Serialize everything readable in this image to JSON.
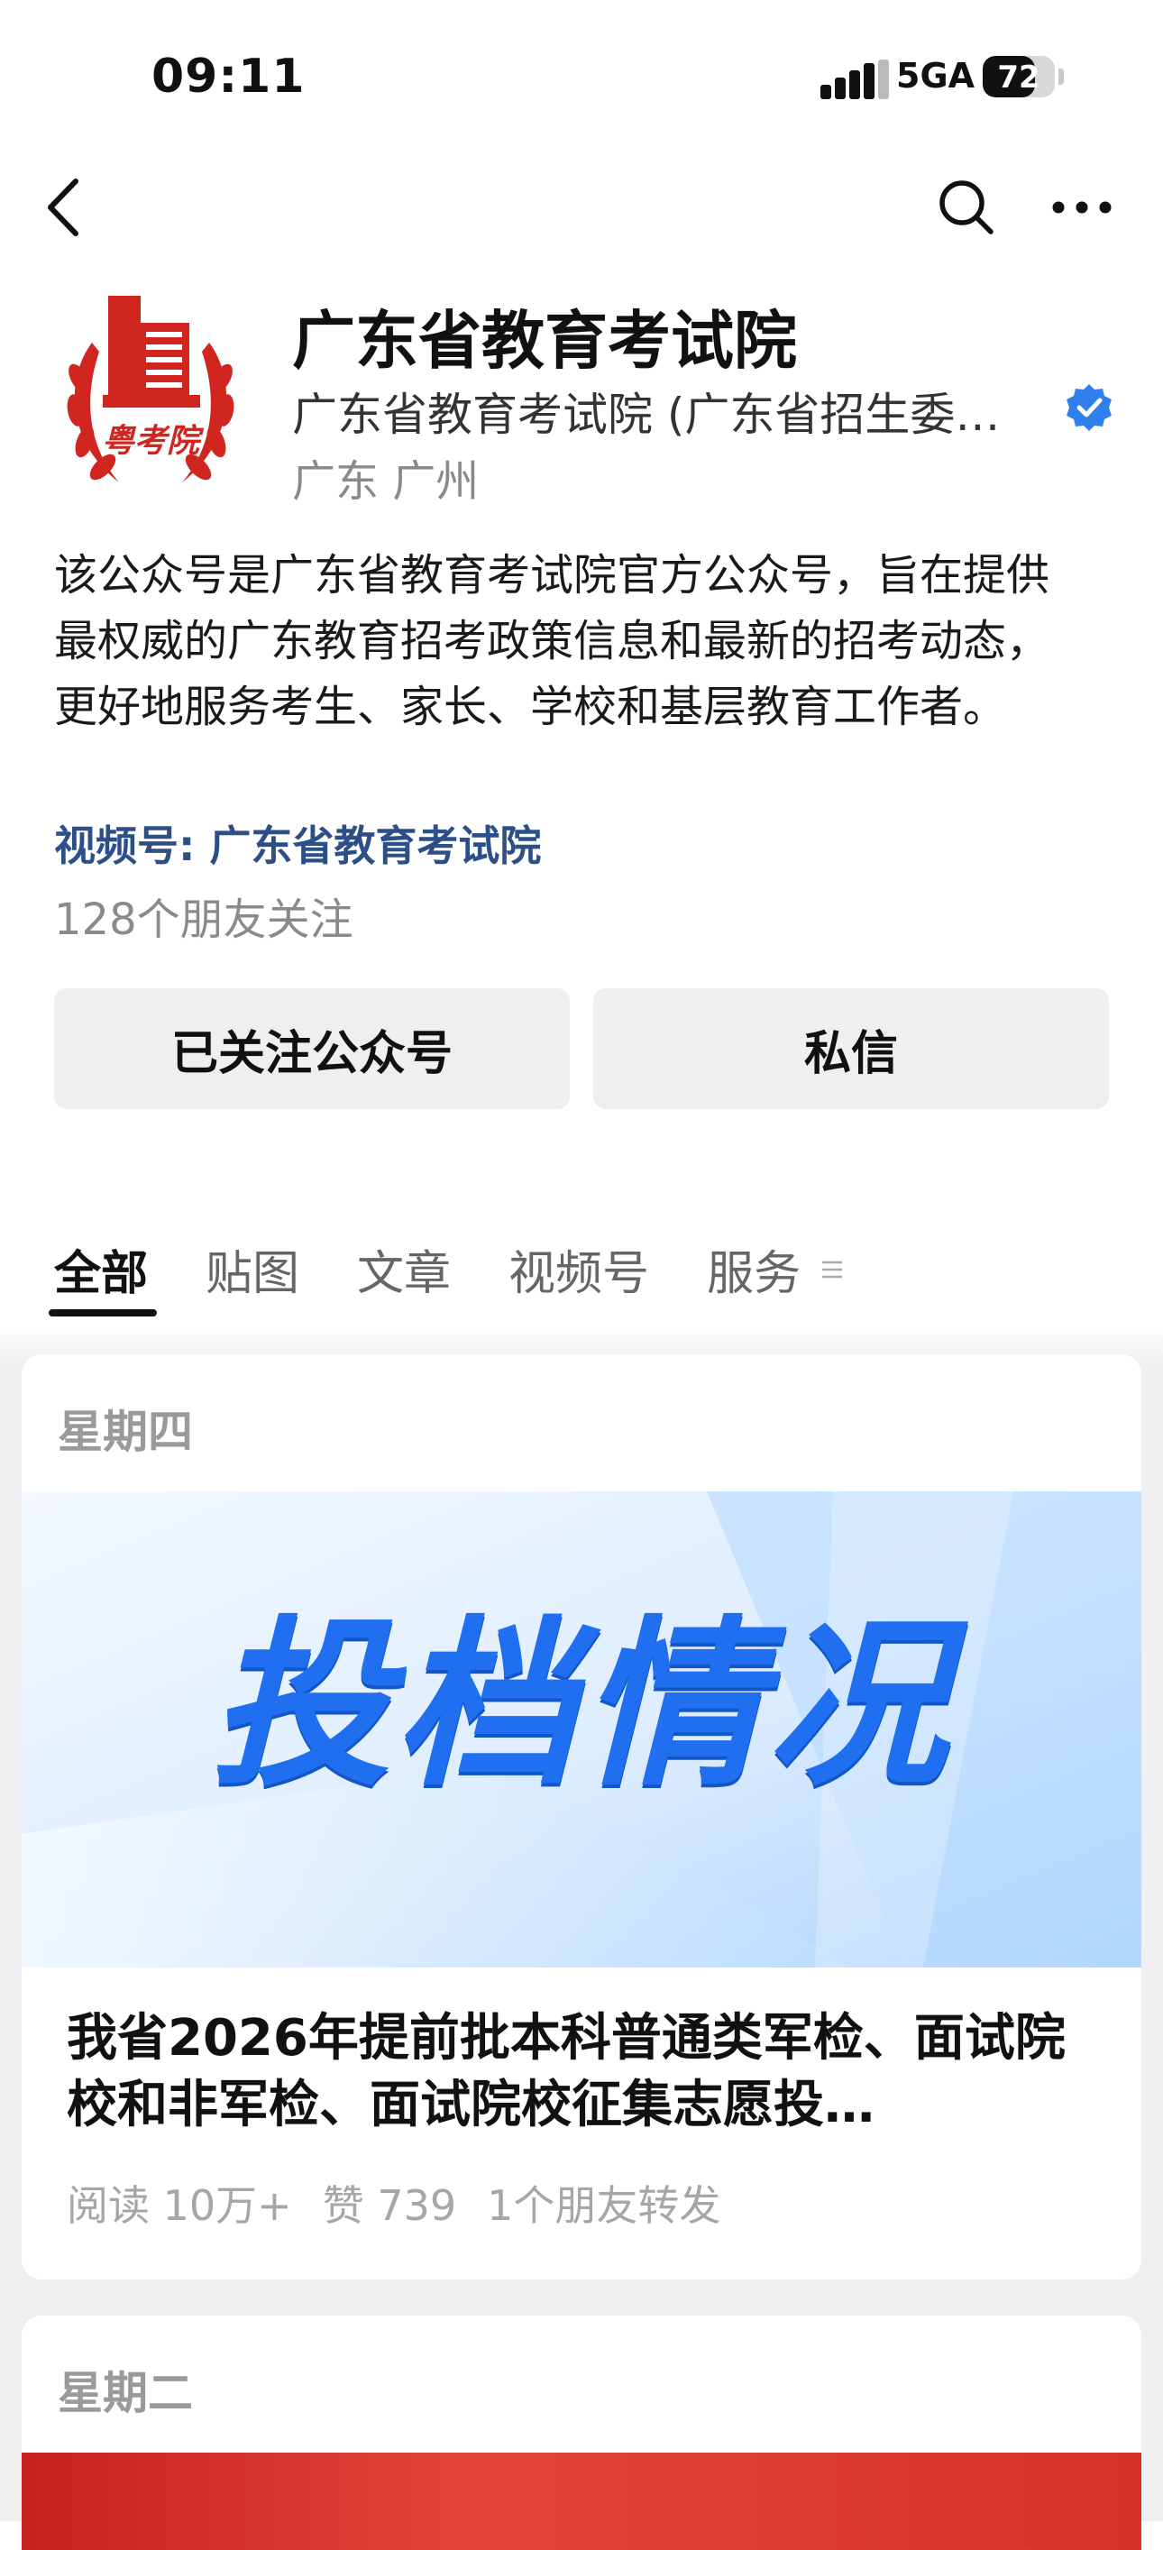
{
  "status_bar": {
    "time": "09:11",
    "network": "5GA",
    "battery": "72",
    "battery_level": 0.72
  },
  "nav": {
    "back_icon": "chevron-left-icon",
    "search_icon": "search-icon",
    "more_icon": "more-dots-icon"
  },
  "profile": {
    "logo_text": "粤考院",
    "name": "广东省教育考试院",
    "subject": "广东省教育考试院 (广东省招生委…",
    "location": "广东 广州",
    "intro": "该公众号是广东省教育考试院官方公众号，旨在提供最权威的广东教育招考政策信息和最新的招考动态，更好地服务考生、家长、学校和基层教育工作者。",
    "channel": "视频号: 广东省教育考试院",
    "friends_following": "128个朋友关注"
  },
  "actions": {
    "follow_label": "已关注公众号",
    "message_label": "私信"
  },
  "tabs": [
    "全部",
    "贴图",
    "文章",
    "视频号",
    "服务"
  ],
  "feed": {
    "card1": {
      "day": "星期四",
      "banner_text": "投档情况",
      "title": "我省2026年提前批本科普通类军检、面试院校和非军检、面试院校征集志愿投…",
      "reads": "阅读 10万+",
      "likes": "赞 739",
      "shares": "1个朋友转发"
    },
    "card2": {
      "day": "星期二"
    }
  },
  "colors": {
    "brand_red": "#d0261f",
    "link_blue": "#2d4f88",
    "verified_blue": "#2f80ed",
    "banner_blue": "#1f6ff0"
  }
}
